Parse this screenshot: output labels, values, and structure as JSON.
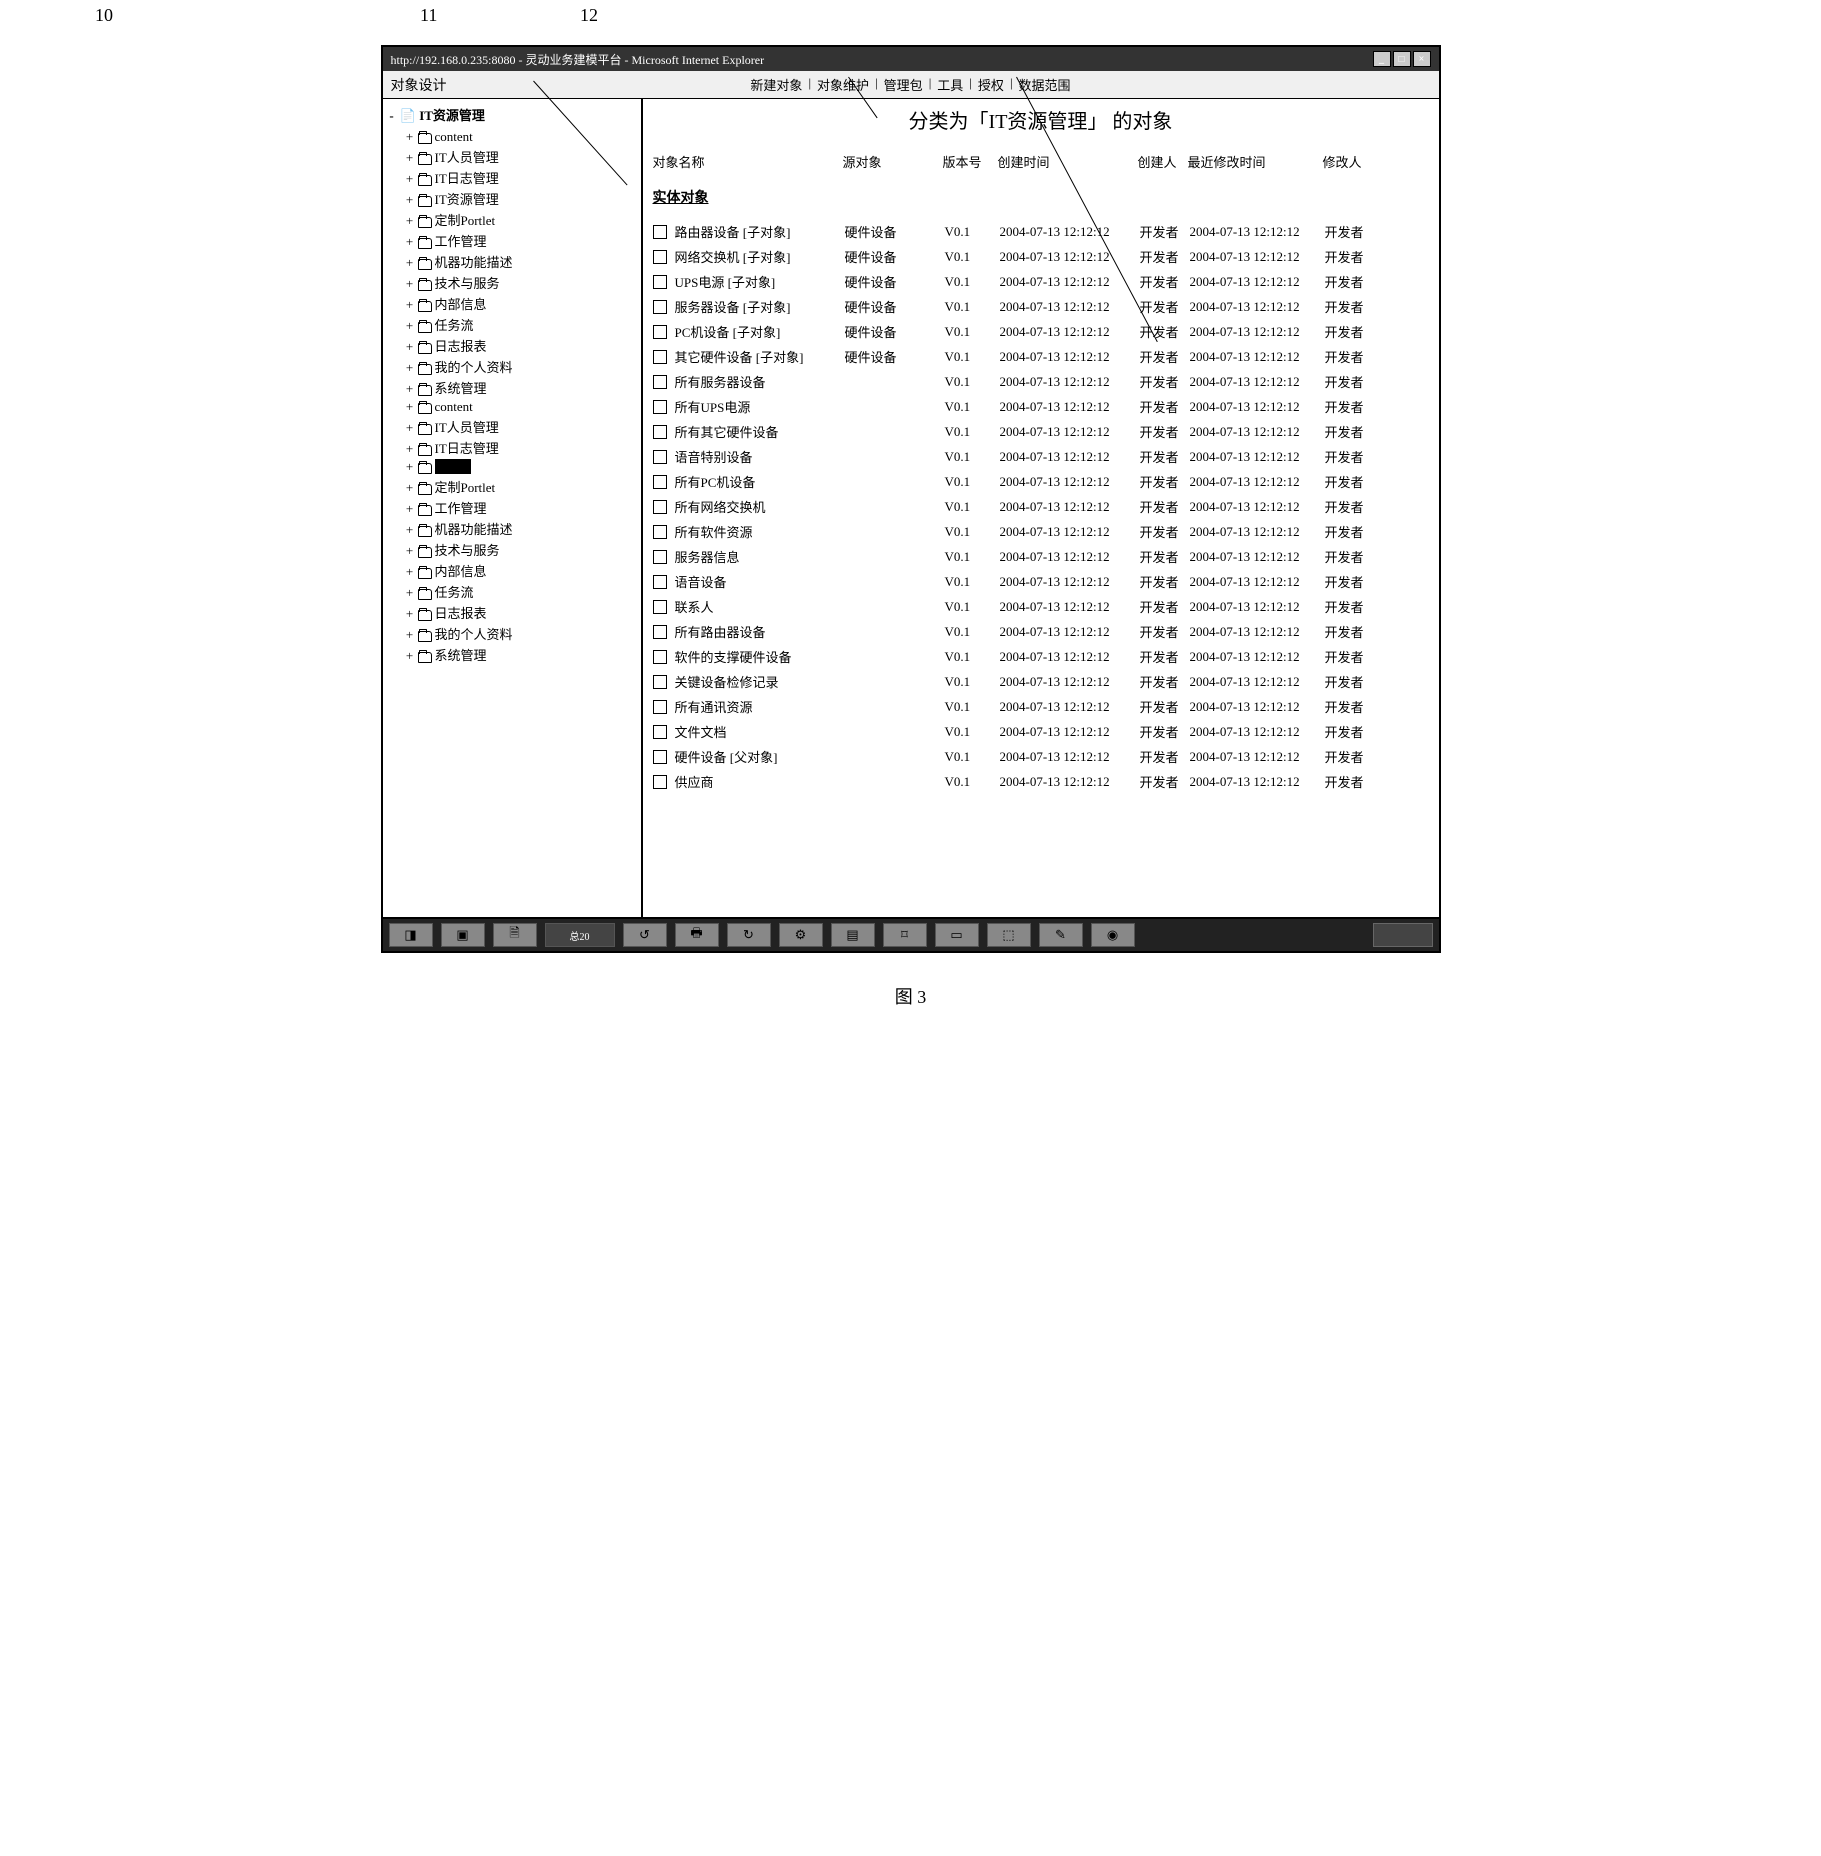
{
  "annotations": {
    "a10": "10",
    "a11": "11",
    "a12": "12"
  },
  "window": {
    "title": "http://192.168.0.235:8080 - 灵动业务建模平台 - Microsoft Internet Explorer"
  },
  "toolbar": {
    "title": "对象设计",
    "menu": [
      "新建对象",
      "对象维护",
      "管理包",
      "工具",
      "授权",
      "数据范围"
    ]
  },
  "sidebar": {
    "root": "IT资源管理",
    "items": [
      {
        "label": "content"
      },
      {
        "label": "IT人员管理"
      },
      {
        "label": "IT日志管理"
      },
      {
        "label": "IT资源管理"
      },
      {
        "label": "定制Portlet"
      },
      {
        "label": "工作管理"
      },
      {
        "label": "机器功能描述"
      },
      {
        "label": "技术与服务"
      },
      {
        "label": "内部信息"
      },
      {
        "label": "任务流"
      },
      {
        "label": "日志报表"
      },
      {
        "label": "我的个人资料"
      },
      {
        "label": "系统管理"
      },
      {
        "label": "content"
      },
      {
        "label": "IT人员管理"
      },
      {
        "label": "IT日志管理"
      },
      {
        "label": "",
        "selected": true
      },
      {
        "label": "定制Portlet"
      },
      {
        "label": "工作管理"
      },
      {
        "label": "机器功能描述"
      },
      {
        "label": "技术与服务"
      },
      {
        "label": "内部信息"
      },
      {
        "label": "任务流"
      },
      {
        "label": "日志报表"
      },
      {
        "label": "我的个人资料"
      },
      {
        "label": "系统管理"
      }
    ]
  },
  "content": {
    "title_prefix": "分类为「",
    "title_category": "IT资源管理",
    "title_suffix": "」 的对象",
    "headers": {
      "name": "对象名称",
      "source": "源对象",
      "version": "版本号",
      "created": "创建时间",
      "creator": "创建人",
      "modified": "最近修改时间",
      "modifier": "修改人"
    },
    "section": "实体对象",
    "rows": [
      {
        "name": "路由器设备 [子对象]",
        "source": "硬件设备",
        "version": "V0.1",
        "created": "2004-07-13 12:12:12",
        "creator": "开发者",
        "modified": "2004-07-13 12:12:12",
        "modifier": "开发者"
      },
      {
        "name": "网络交换机 [子对象]",
        "source": "硬件设备",
        "version": "V0.1",
        "created": "2004-07-13 12:12:12",
        "creator": "开发者",
        "modified": "2004-07-13 12:12:12",
        "modifier": "开发者"
      },
      {
        "name": "UPS电源 [子对象]",
        "source": "硬件设备",
        "version": "V0.1",
        "created": "2004-07-13 12:12:12",
        "creator": "开发者",
        "modified": "2004-07-13 12:12:12",
        "modifier": "开发者"
      },
      {
        "name": "服务器设备 [子对象]",
        "source": "硬件设备",
        "version": "V0.1",
        "created": "2004-07-13 12:12:12",
        "creator": "开发者",
        "modified": "2004-07-13 12:12:12",
        "modifier": "开发者"
      },
      {
        "name": "PC机设备 [子对象]",
        "source": "硬件设备",
        "version": "V0.1",
        "created": "2004-07-13 12:12:12",
        "creator": "开发者",
        "modified": "2004-07-13 12:12:12",
        "modifier": "开发者"
      },
      {
        "name": "其它硬件设备 [子对象]",
        "source": "硬件设备",
        "version": "V0.1",
        "created": "2004-07-13 12:12:12",
        "creator": "开发者",
        "modified": "2004-07-13 12:12:12",
        "modifier": "开发者"
      },
      {
        "name": "所有服务器设备",
        "source": "",
        "version": "V0.1",
        "created": "2004-07-13 12:12:12",
        "creator": "开发者",
        "modified": "2004-07-13 12:12:12",
        "modifier": "开发者"
      },
      {
        "name": "所有UPS电源",
        "source": "",
        "version": "V0.1",
        "created": "2004-07-13 12:12:12",
        "creator": "开发者",
        "modified": "2004-07-13 12:12:12",
        "modifier": "开发者"
      },
      {
        "name": "所有其它硬件设备",
        "source": "",
        "version": "V0.1",
        "created": "2004-07-13 12:12:12",
        "creator": "开发者",
        "modified": "2004-07-13 12:12:12",
        "modifier": "开发者"
      },
      {
        "name": "语音特别设备",
        "source": "",
        "version": "V0.1",
        "created": "2004-07-13 12:12:12",
        "creator": "开发者",
        "modified": "2004-07-13 12:12:12",
        "modifier": "开发者"
      },
      {
        "name": "所有PC机设备",
        "source": "",
        "version": "V0.1",
        "created": "2004-07-13 12:12:12",
        "creator": "开发者",
        "modified": "2004-07-13 12:12:12",
        "modifier": "开发者"
      },
      {
        "name": "所有网络交换机",
        "source": "",
        "version": "V0.1",
        "created": "2004-07-13 12:12:12",
        "creator": "开发者",
        "modified": "2004-07-13 12:12:12",
        "modifier": "开发者"
      },
      {
        "name": "所有软件资源",
        "source": "",
        "version": "V0.1",
        "created": "2004-07-13 12:12:12",
        "creator": "开发者",
        "modified": "2004-07-13 12:12:12",
        "modifier": "开发者"
      },
      {
        "name": "服务器信息",
        "source": "",
        "version": "V0.1",
        "created": "2004-07-13 12:12:12",
        "creator": "开发者",
        "modified": "2004-07-13 12:12:12",
        "modifier": "开发者"
      },
      {
        "name": "语音设备",
        "source": "",
        "version": "V0.1",
        "created": "2004-07-13 12:12:12",
        "creator": "开发者",
        "modified": "2004-07-13 12:12:12",
        "modifier": "开发者"
      },
      {
        "name": "联系人",
        "source": "",
        "version": "V0.1",
        "created": "2004-07-13 12:12:12",
        "creator": "开发者",
        "modified": "2004-07-13 12:12:12",
        "modifier": "开发者"
      },
      {
        "name": "所有路由器设备",
        "source": "",
        "version": "V0.1",
        "created": "2004-07-13 12:12:12",
        "creator": "开发者",
        "modified": "2004-07-13 12:12:12",
        "modifier": "开发者"
      },
      {
        "name": "软件的支撑硬件设备",
        "source": "",
        "version": "V0.1",
        "created": "2004-07-13 12:12:12",
        "creator": "开发者",
        "modified": "2004-07-13 12:12:12",
        "modifier": "开发者"
      },
      {
        "name": "关键设备检修记录",
        "source": "",
        "version": "V0.1",
        "created": "2004-07-13 12:12:12",
        "creator": "开发者",
        "modified": "2004-07-13 12:12:12",
        "modifier": "开发者"
      },
      {
        "name": "所有通讯资源",
        "source": "",
        "version": "V0.1",
        "created": "2004-07-13 12:12:12",
        "creator": "开发者",
        "modified": "2004-07-13 12:12:12",
        "modifier": "开发者"
      },
      {
        "name": "文件文档",
        "source": "",
        "version": "V0.1",
        "created": "2004-07-13 12:12:12",
        "creator": "开发者",
        "modified": "2004-07-13 12:12:12",
        "modifier": "开发者"
      },
      {
        "name": "硬件设备 [父对象]",
        "source": "",
        "version": "V0.1",
        "created": "2004-07-13 12:12:12",
        "creator": "开发者",
        "modified": "2004-07-13 12:12:12",
        "modifier": "开发者"
      },
      {
        "name": "供应商",
        "source": "",
        "version": "V0.1",
        "created": "2004-07-13 12:12:12",
        "creator": "开发者",
        "modified": "2004-07-13 12:12:12",
        "modifier": "开发者"
      }
    ]
  },
  "taskbar": {
    "badge": "总20"
  },
  "figure": "图 3"
}
